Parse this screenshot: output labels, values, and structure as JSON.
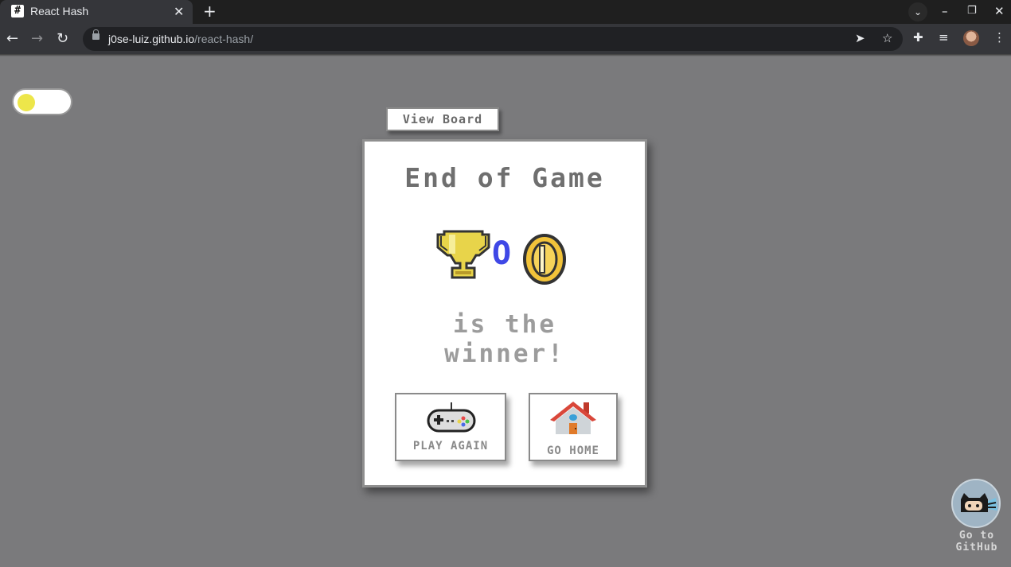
{
  "browser": {
    "tab_title": "React Hash",
    "tab_favicon": "#",
    "url_host": "j0se-luiz.github.io",
    "url_path": "/react-hash/",
    "icons": [
      "back-icon",
      "forward-icon",
      "reload-icon",
      "lock-icon",
      "send-icon",
      "star-icon",
      "extensions-icon",
      "media-icon",
      "profile-avatar",
      "menu-icon",
      "tab-search-icon",
      "minimize-icon",
      "restore-icon",
      "close-icon"
    ]
  },
  "page": {
    "theme_toggle_state": "light",
    "view_board_label": "View Board",
    "card": {
      "title": "End of Game",
      "winner_symbol": "O",
      "winner_line1": "is the",
      "winner_line2": "winner!",
      "play_again_label": "PLAY AGAIN",
      "go_home_label": "GO HOME"
    },
    "github_link": {
      "line1": "Go to",
      "line2": "GitHub"
    }
  },
  "colors": {
    "page_bg": "#7a7a7c",
    "winner_symbol": "#3f48e6",
    "toggle_knob": "#ede64a",
    "trophy": "#e8d44a",
    "coin": "#f2c33a"
  }
}
